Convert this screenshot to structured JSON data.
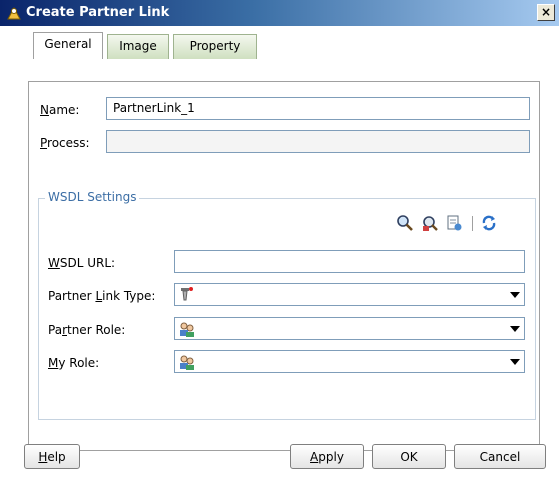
{
  "window": {
    "title": "Create Partner Link",
    "close_label": "×"
  },
  "tabs": [
    {
      "label": "General",
      "active": true
    },
    {
      "label": "Image",
      "active": false
    },
    {
      "label": "Property",
      "active": false
    }
  ],
  "form": {
    "name_label_key": "N",
    "name_label_rest": "ame:",
    "name_value": "PartnerLink_1",
    "process_label_key": "P",
    "process_label_rest": "rocess:",
    "process_value": ""
  },
  "wsdl": {
    "legend": "WSDL Settings",
    "url_label_key": "W",
    "url_label_rest": "SDL URL:",
    "url_value": "",
    "plt_label_pre": "Partner ",
    "plt_label_key": "L",
    "plt_label_rest": "ink Type:",
    "pr_label_pre": "Pa",
    "pr_label_key": "r",
    "pr_label_rest": "tner Role:",
    "mr_label_key": "M",
    "mr_label_rest": "y Role:",
    "toolbar_icons": [
      "search-icon",
      "browse-icon",
      "import-icon",
      "refresh-icon"
    ]
  },
  "buttons": {
    "help_key": "H",
    "help_rest": "elp",
    "apply_key": "A",
    "apply_rest": "pply",
    "ok": "OK",
    "cancel": "Cancel"
  }
}
